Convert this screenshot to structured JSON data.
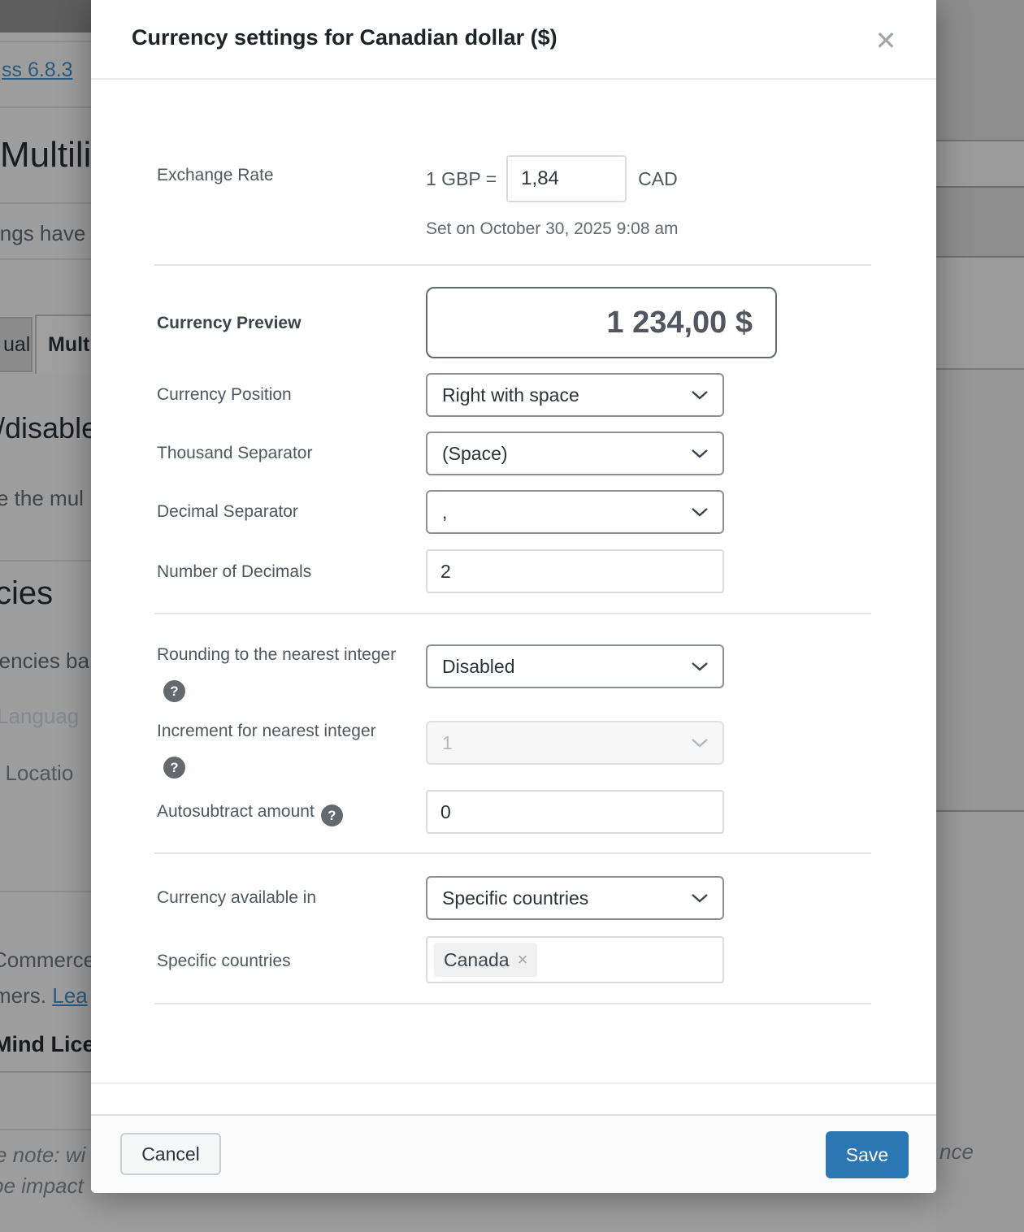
{
  "modal": {
    "title": "Currency settings for Canadian dollar ($)",
    "close_icon": "✕",
    "help_icon": "?",
    "exchange_rate": {
      "label": "Exchange Rate",
      "prefix": "1 GBP =",
      "value": "1,84",
      "suffix": "CAD",
      "set_on": "Set on October 30, 2025 9:08 am"
    },
    "preview": {
      "label": "Currency Preview",
      "value": "1 234,00 $"
    },
    "currency_position": {
      "label": "Currency Position",
      "value": "Right with space"
    },
    "thousand_separator": {
      "label": "Thousand Separator",
      "value": "(Space)"
    },
    "decimal_separator": {
      "label": "Decimal Separator",
      "value": ","
    },
    "number_of_decimals": {
      "label": "Number of Decimals",
      "value": "2"
    },
    "rounding": {
      "label": "Rounding to the nearest integer",
      "value": "Disabled"
    },
    "increment": {
      "label": "Increment for nearest integer",
      "value": "1",
      "disabled": "true"
    },
    "autosubtract": {
      "label": "Autosubtract amount",
      "value": "0"
    },
    "available_in": {
      "label": "Currency available in",
      "value": "Specific countries"
    },
    "specific_countries": {
      "label": "Specific countries",
      "tags": [
        {
          "label": "Canada",
          "remove": "×"
        }
      ]
    },
    "footer": {
      "cancel": "Cancel",
      "save": "Save"
    }
  },
  "background": {
    "wp_version_link": "ss 6.8.3",
    "heading_multilingual": "Multili",
    "text_settings_have": "ings have",
    "tab_inactive": "ual",
    "tab_active": "Mult",
    "heading_disable": "/disable",
    "text_the_mul": "e the mul",
    "heading_currencies": "cies",
    "text_currencies_ba": "rencies ba",
    "text_language": "Languag",
    "text_location": "t Locatio",
    "text_commerce": "Commerce",
    "text_customers": "mers. ",
    "link_learn": "Lea",
    "text_mind_license": "Mind Lice",
    "note_line1": "e note: wi",
    "note_line2": "be impact",
    "note_right": "nce"
  },
  "colors": {
    "accent": "#2b77b4",
    "link": "#2a5a7d",
    "backdrop": "#9d9d9d"
  }
}
